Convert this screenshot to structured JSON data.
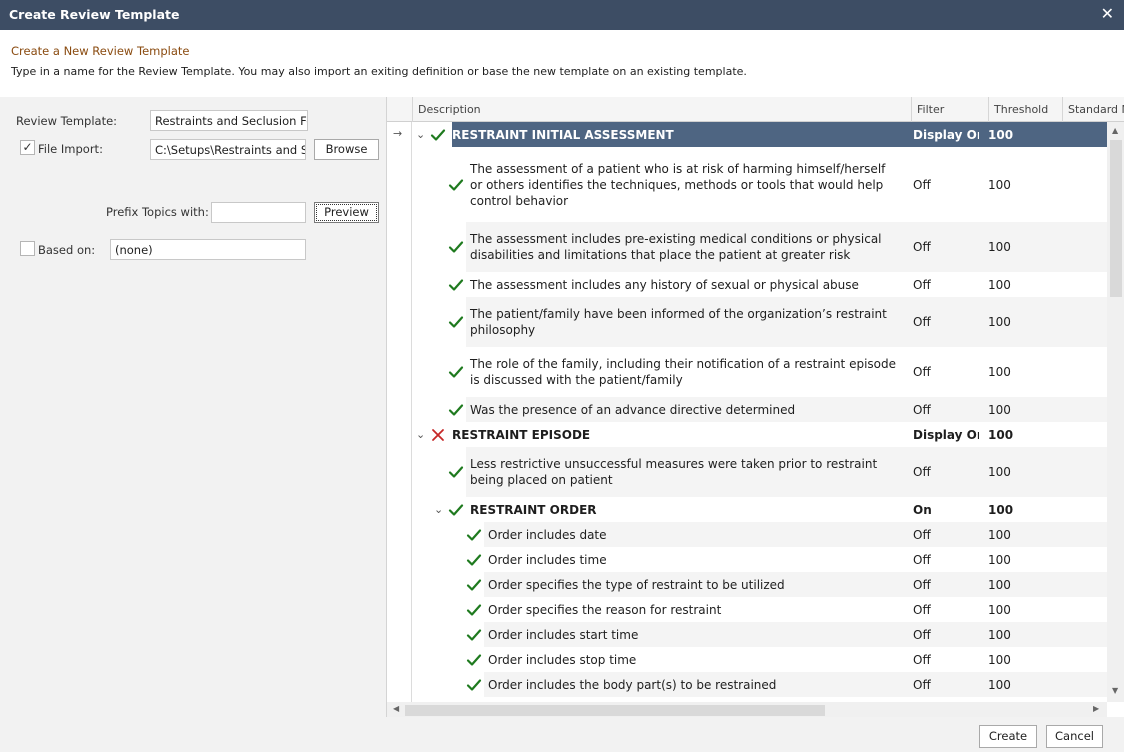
{
  "window": {
    "title": "Create Review Template",
    "close_glyph": "✕"
  },
  "header": {
    "heading": "Create a New Review Template",
    "instructions": "Type in a name for the Review Template. You may also import an exiting definition or base the new template on an existing template."
  },
  "form": {
    "review_template_label": "Review Template:",
    "review_template_value": "Restraints and Seclusion Focus",
    "file_import_label": "File Import:",
    "file_import_checked": true,
    "file_import_value": "C:\\Setups\\Restraints and Seclusion",
    "browse_label": "Browse",
    "prefix_label": "Prefix Topics with:",
    "prefix_value": "",
    "preview_label": "Preview",
    "based_on_label": "Based on:",
    "based_on_checked": false,
    "based_on_value": "(none)"
  },
  "grid": {
    "columns": [
      "Description",
      "Filter",
      "Threshold",
      "Standard No"
    ],
    "current_row_indicator": "→",
    "rows": [
      {
        "level": 0,
        "group": true,
        "expanded": true,
        "status": "check",
        "selected": true,
        "description": "RESTRAINT INITIAL ASSESSMENT",
        "filter": "Display On",
        "threshold": "100"
      },
      {
        "level": 1,
        "group": false,
        "status": "check",
        "description": "The assessment of a patient who is at risk of harming himself/herself or others identifies the techniques, methods or tools that would help control behavior",
        "filter": "Off",
        "threshold": "100"
      },
      {
        "level": 1,
        "group": false,
        "status": "check",
        "description": "The assessment includes pre-existing medical conditions or physical disabilities and limitations that place the patient at greater risk",
        "filter": "Off",
        "threshold": "100"
      },
      {
        "level": 1,
        "group": false,
        "status": "check",
        "description": "The assessment includes any history of sexual or physical abuse",
        "filter": "Off",
        "threshold": "100"
      },
      {
        "level": 1,
        "group": false,
        "status": "check",
        "description": "The patient/family have been informed of the organization’s restraint philosophy",
        "filter": "Off",
        "threshold": "100"
      },
      {
        "level": 1,
        "group": false,
        "status": "check",
        "description": "The role of the family, including their notification of a restraint episode is discussed with the patient/family",
        "filter": "Off",
        "threshold": "100"
      },
      {
        "level": 1,
        "group": false,
        "status": "check",
        "description": "Was the presence of an advance directive determined",
        "filter": "Off",
        "threshold": "100"
      },
      {
        "level": 0,
        "group": true,
        "expanded": true,
        "status": "cross",
        "description": "RESTRAINT EPISODE",
        "filter": "Display On",
        "threshold": "100"
      },
      {
        "level": 1,
        "group": false,
        "status": "check",
        "description": "Less restrictive unsuccessful measures were taken prior to restraint being placed on patient",
        "filter": "Off",
        "threshold": "100"
      },
      {
        "level": 1,
        "group": true,
        "expanded": true,
        "status": "check",
        "description": "RESTRAINT ORDER",
        "filter": "On",
        "threshold": "100"
      },
      {
        "level": 2,
        "group": false,
        "status": "check",
        "description": "Order includes date",
        "filter": "Off",
        "threshold": "100"
      },
      {
        "level": 2,
        "group": false,
        "status": "check",
        "description": "Order includes time",
        "filter": "Off",
        "threshold": "100"
      },
      {
        "level": 2,
        "group": false,
        "status": "check",
        "description": "Order specifies the type of restraint to be utilized",
        "filter": "Off",
        "threshold": "100"
      },
      {
        "level": 2,
        "group": false,
        "status": "check",
        "description": "Order specifies the reason for restraint",
        "filter": "Off",
        "threshold": "100"
      },
      {
        "level": 2,
        "group": false,
        "status": "check",
        "description": "Order includes start time",
        "filter": "Off",
        "threshold": "100"
      },
      {
        "level": 2,
        "group": false,
        "status": "check",
        "description": "Order includes stop time",
        "filter": "Off",
        "threshold": "100"
      },
      {
        "level": 2,
        "group": false,
        "status": "check",
        "description": "Order includes the body part(s) to be restrained",
        "filter": "Off",
        "threshold": "100"
      }
    ]
  },
  "footer": {
    "create_label": "Create",
    "cancel_label": "Cancel"
  },
  "colors": {
    "titlebar": "#3d4d64",
    "heading": "#8a4b10",
    "selection": "#4e6582",
    "check": "#1f7a1f",
    "cross": "#c62828"
  },
  "icons": {
    "check": "check-icon",
    "cross": "cross-icon",
    "expand": "chevron-down-icon"
  }
}
